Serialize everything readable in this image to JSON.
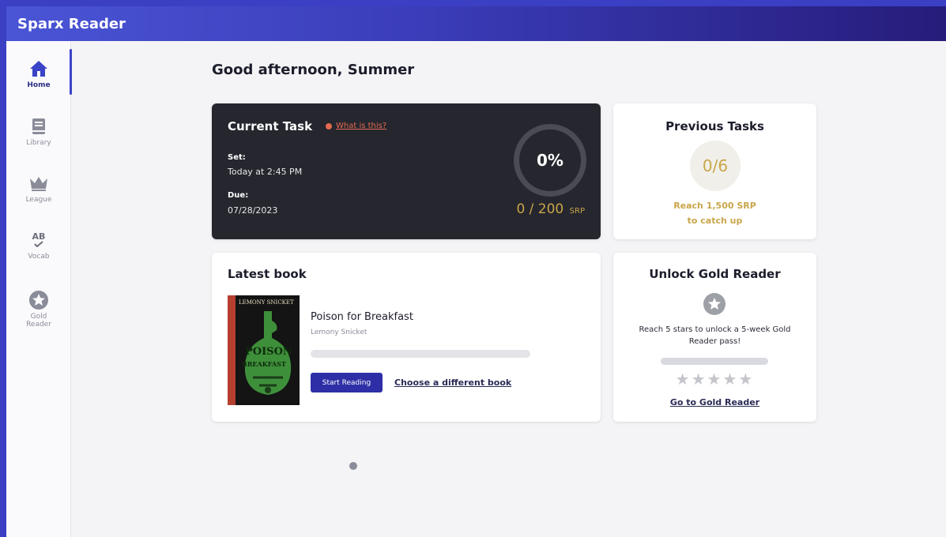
{
  "app": {
    "title": "Sparx Reader"
  },
  "sidebar": {
    "items": [
      {
        "label": "Home",
        "icon": "home-icon",
        "active": true
      },
      {
        "label": "Library",
        "icon": "book-icon"
      },
      {
        "label": "League",
        "icon": "crown-icon"
      },
      {
        "label": "Vocab",
        "icon": "vocab-icon",
        "icon_text": "AB"
      },
      {
        "label": "Gold Reader",
        "icon": "star-icon"
      }
    ]
  },
  "greeting": "Good afternoon, Summer",
  "current_task": {
    "title": "Current Task",
    "help_link": "What is this?",
    "set_label": "Set:",
    "set_value": "Today at 2:45 PM",
    "due_label": "Due:",
    "due_value": "07/28/2023",
    "progress_percent": 0,
    "progress_text": "0%",
    "srp_value": "0 / 200",
    "srp_unit": "SRP"
  },
  "previous_tasks": {
    "title": "Previous Tasks",
    "count": "0/6",
    "note_line1": "Reach 1,500 SRP",
    "note_line2": "to catch up"
  },
  "latest_book": {
    "heading": "Latest book",
    "title": "Poison for Breakfast",
    "author": "Lemony Snicket",
    "cover_author": "LEMONY SNICKET",
    "cover_title_line1": "POISON",
    "cover_title_line2": "BREAKFAST",
    "progress_fraction": 0,
    "start_button": "Start Reading",
    "choose_link": "Choose a different book"
  },
  "gold_reader": {
    "title": "Unlock Gold Reader",
    "description": "Reach 5 stars to unlock a 5-week Gold Reader pass!",
    "stars": "★★★★★",
    "stars_earned": 0,
    "stars_total": 5,
    "link": "Go to Gold Reader"
  },
  "colors": {
    "accent": "#3b43c6",
    "task_card_bg": "#25262e",
    "gold": "#c9a64a",
    "link_red": "#e36a4f",
    "button": "#2e2fa6"
  }
}
